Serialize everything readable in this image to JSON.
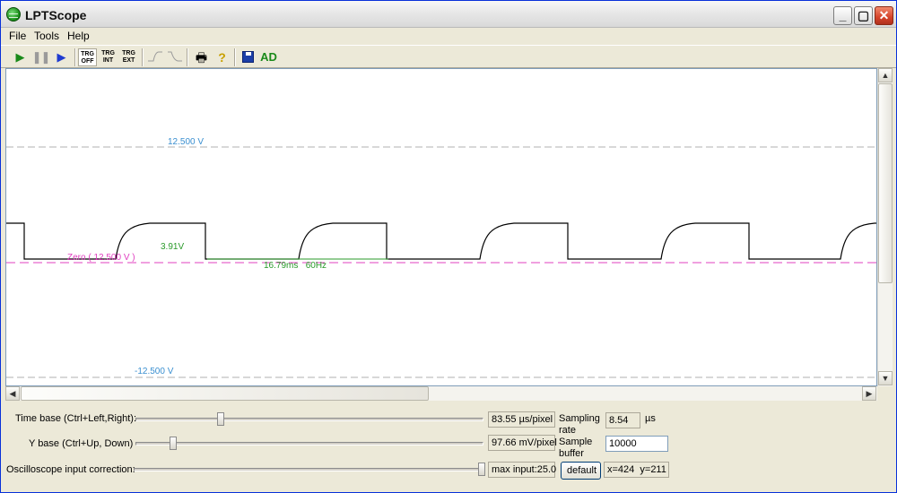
{
  "window": {
    "title": "LPTScope"
  },
  "menu": [
    "File",
    "Tools",
    "Help"
  ],
  "toolbar": {
    "trg_off": [
      "TRG",
      "OFF"
    ],
    "trg_int": [
      "TRG",
      "INT"
    ],
    "trg_ext": [
      "TRG",
      "EXT"
    ],
    "ad_label": "AD"
  },
  "scope": {
    "top_level_label": "12.500 V",
    "bottom_level_label": "-12.500 V",
    "zero_label": "Zero ( 12.500 V )",
    "amplitude_label": "3.91V",
    "period_label": "16.79ms   60Hz",
    "colors": {
      "level_lines": "#b0b0b0",
      "zero_line": "#e040c0",
      "trace": "#000000",
      "measure": "#2a9a2a",
      "level_text": "#3a8fd0"
    }
  },
  "controls": {
    "time_base_label": "Time base (Ctrl+Left,Right):",
    "time_base_value": "83.55 µs/pixel",
    "time_base_level": 0.24,
    "y_base_label": "Y base (Ctrl+Up, Down)",
    "y_base_value": "97.66 mV/pixel",
    "y_base_level": 0.1,
    "correction_label": "Oscilloscope input correction:",
    "correction_value": "max input:25.0",
    "correction_level": 1.0,
    "sampling_rate_label_1": "Sampling",
    "sampling_rate_label_2": "rate",
    "sampling_rate_value": "8.54",
    "sampling_rate_unit": "µs",
    "sample_buffer_label_1": "Sample",
    "sample_buffer_label_2": "buffer",
    "sample_buffer_value": "10000",
    "default_button": "default",
    "cursor_readout": "x=424  y=211"
  }
}
